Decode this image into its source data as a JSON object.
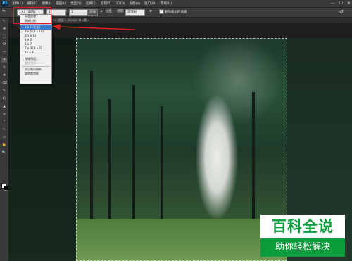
{
  "menubar": {
    "logo": "Ps",
    "items": [
      "文件(F)",
      "编辑(E)",
      "图像(I)",
      "图层(L)",
      "类型(Y)",
      "选择(S)",
      "滤镜(T)",
      "3D(D)",
      "视图(V)",
      "窗口(W)",
      "帮助(H)"
    ],
    "window_controls": [
      "—",
      "☐",
      "✕"
    ]
  },
  "options": {
    "ratio_value": "1×2 (竖向)",
    "field_a": "1",
    "field_b": "1",
    "clear_button": "清除",
    "straighten_label": "拉直",
    "view_label": "视图:",
    "view_value": "三等分",
    "delete_pixels_label": "删除裁剪的像素"
  },
  "doc_tabs": [
    "72% (图层 0, RGB/8) *",
    "未标题-1"
  ],
  "dropdown": {
    "items": [
      {
        "label": "不受约束",
        "state": "normal"
      },
      {
        "label": "原始比例",
        "state": "normal"
      },
      {
        "sep": true
      },
      {
        "label": "1 x 1 (方形)",
        "state": "selected"
      },
      {
        "label": "4 x 5 (8 x 10)",
        "state": "normal"
      },
      {
        "label": "8.5 x 11",
        "state": "normal"
      },
      {
        "label": "4 x 3",
        "state": "normal"
      },
      {
        "label": "5 x 7",
        "state": "normal"
      },
      {
        "label": "2 x 3 (4 x 6)",
        "state": "normal"
      },
      {
        "label": "16 x 9",
        "state": "normal"
      },
      {
        "sep": true
      },
      {
        "label": "存储预设...",
        "state": "normal"
      },
      {
        "label": "删除预设...",
        "state": "muted"
      },
      {
        "sep": true
      },
      {
        "label": "大小和分辨率...",
        "state": "normal"
      },
      {
        "label": "旋转裁剪框",
        "state": "normal"
      }
    ]
  },
  "tools": [
    "↖",
    "✥",
    "⬚",
    "ʘ",
    "✂",
    "⌗",
    "✎",
    "✚",
    "⌫",
    "✎",
    "◐",
    "▲",
    "⌀",
    "T",
    "↖",
    "▭",
    "✋",
    "🔍"
  ],
  "watermark": {
    "top": "百科全说",
    "bottom": "助你轻松解决"
  },
  "colors": {
    "highlight": "#e02020",
    "accent": "#3a7bd5",
    "watermark_green": "#0b9c3b"
  }
}
